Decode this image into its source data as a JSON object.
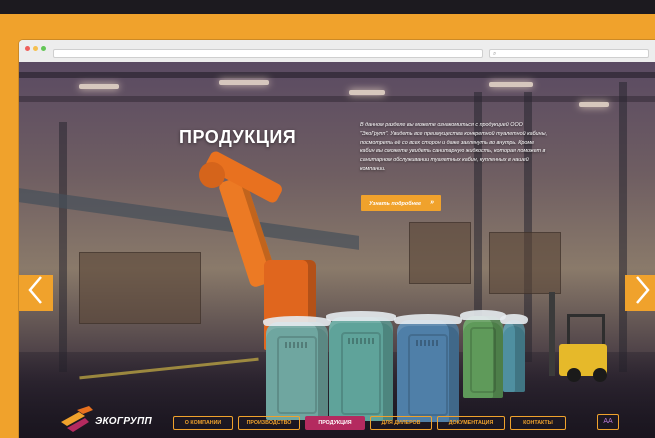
{
  "browser": {
    "address_text": "",
    "nav_glyphs": "◀ ▶"
  },
  "hero": {
    "title": "ПРОДУКЦИЯ",
    "description": "В данном разделе вы можете ознакомиться с продукцией ООО \"ЭкоГрупп\". Увидеть все преимущества конкретной туалетной кабины, посмотреть её со всех сторон и даже заглянуть во внутрь. Кроме кабин вы сможете увидеть санитарную жидкость, которая поможет в санитарном обслуживании туалетных кабин, купленных в нашей компании.",
    "more_button": "Узнать подробнее",
    "more_chevron": "»"
  },
  "logo": {
    "text": "ЭКОГРУПП"
  },
  "menu": {
    "items": [
      {
        "label": "О КОМПАНИИ",
        "active": false
      },
      {
        "label": "ПРОИЗВОДСТВО",
        "active": false
      },
      {
        "label": "ПРОДУКЦИЯ",
        "active": true
      },
      {
        "label": "ДЛЯ ДИЛЕРОВ",
        "active": false
      },
      {
        "label": "ДОКУМЕНТАЦИЯ",
        "active": false
      },
      {
        "label": "КОНТАКТЫ",
        "active": false
      }
    ]
  },
  "lang_button": "AA",
  "colors": {
    "accent": "#f0a22c",
    "active_menu": "#b42a5f",
    "cabin_teal": "#5fa39a",
    "cabin_green": "#5f9a5a",
    "robot_orange": "#e8711f"
  },
  "icons": {
    "prev_arrow": "chevron-left-icon",
    "next_arrow": "chevron-right-icon",
    "logo_mark": "ecogroup-logo-icon"
  }
}
